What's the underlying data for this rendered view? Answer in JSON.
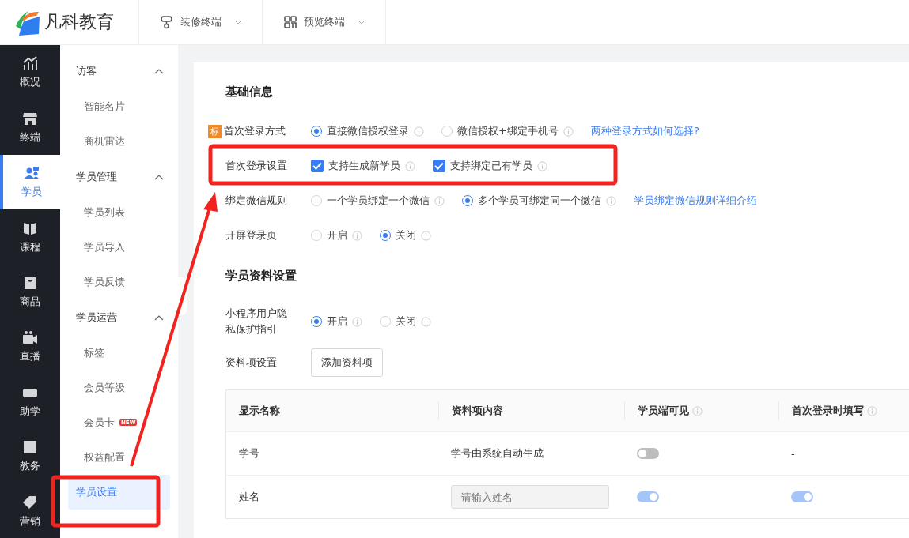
{
  "header": {
    "logo": "凡科教育",
    "menus": [
      {
        "label": "装修终端"
      },
      {
        "label": "预览终端"
      }
    ]
  },
  "nav": [
    {
      "label": "概况",
      "selected": false
    },
    {
      "label": "终端",
      "selected": false
    },
    {
      "label": "学员",
      "selected": true
    },
    {
      "label": "课程",
      "selected": false
    },
    {
      "label": "商品",
      "selected": false
    },
    {
      "label": "直播",
      "selected": false
    },
    {
      "label": "助学",
      "selected": false
    },
    {
      "label": "教务",
      "selected": false
    },
    {
      "label": "营销",
      "selected": false
    }
  ],
  "submenu": [
    {
      "group": "访客",
      "expanded": true,
      "items": [
        {
          "label": "智能名片",
          "selected": false
        },
        {
          "label": "商机雷达",
          "selected": false
        }
      ]
    },
    {
      "group": "学员管理",
      "expanded": true,
      "items": [
        {
          "label": "学员列表",
          "selected": false
        },
        {
          "label": "学员导入",
          "selected": false
        },
        {
          "label": "学员反馈",
          "selected": false
        }
      ]
    },
    {
      "group": "学员运营",
      "expanded": true,
      "items": [
        {
          "label": "标签",
          "selected": false
        },
        {
          "label": "会员等级",
          "selected": false
        },
        {
          "label": "会员卡",
          "badge": "NEW",
          "selected": false
        },
        {
          "label": "权益配置",
          "selected": false
        },
        {
          "label": "学员设置",
          "selected": true
        }
      ]
    }
  ],
  "basic": {
    "title": "基础信息",
    "rows": [
      {
        "tag": "标",
        "label": "首次登录方式",
        "kind": "radio",
        "options": [
          {
            "label": "直接微信授权登录",
            "selected": true
          },
          {
            "label": "微信授权+绑定手机号",
            "selected": false
          }
        ],
        "link": "两种登录方式如何选择?"
      },
      {
        "label": "首次登录设置",
        "kind": "checkbox",
        "options": [
          {
            "label": "支持生成新学员",
            "checked": true
          },
          {
            "label": "支持绑定已有学员",
            "checked": true
          }
        ]
      },
      {
        "label": "绑定微信规则",
        "kind": "radio",
        "options": [
          {
            "label": "一个学员绑定一个微信",
            "selected": false
          },
          {
            "label": "多个学员可绑定同一个微信",
            "selected": true
          }
        ],
        "link": "学员绑定微信规则详细介绍"
      },
      {
        "label": "开屏登录页",
        "kind": "radio",
        "options": [
          {
            "label": "开启",
            "selected": false
          },
          {
            "label": "关闭",
            "selected": true
          }
        ]
      }
    ]
  },
  "profile": {
    "title": "学员资料设置",
    "privacy": {
      "label": "小程序用户隐私保护指引",
      "options": [
        {
          "label": "开启",
          "selected": true
        },
        {
          "label": "关闭",
          "selected": false
        }
      ]
    },
    "items_label": "资料项设置",
    "add_button": "添加资料项",
    "table": {
      "columns": [
        {
          "label": "显示名称",
          "info": false
        },
        {
          "label": "资料项内容",
          "info": false
        },
        {
          "label": "学员端可见",
          "info": true
        },
        {
          "label": "首次登录时填写",
          "info": true
        }
      ],
      "rows": [
        [
          {
            "kind": "text",
            "text": "学号"
          },
          {
            "kind": "text",
            "text": "学号由系统自动生成"
          },
          {
            "kind": "toggle",
            "on": false,
            "disabled": false
          },
          {
            "kind": "text",
            "text": "-"
          }
        ],
        [
          {
            "kind": "text",
            "text": "姓名"
          },
          {
            "kind": "input",
            "placeholder": "请输入姓名"
          },
          {
            "kind": "toggle",
            "on": true,
            "disabled": true
          },
          {
            "kind": "toggle",
            "on": true,
            "disabled": true
          }
        ]
      ]
    }
  }
}
